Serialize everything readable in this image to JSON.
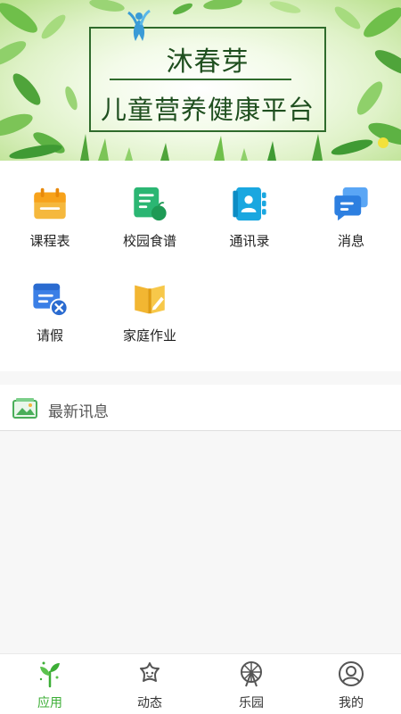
{
  "banner": {
    "title": "沐春芽",
    "subtitle": "儿童营养健康平台"
  },
  "apps": [
    {
      "label": "课程表",
      "icon": "calendar-icon"
    },
    {
      "label": "校园食谱",
      "icon": "recipe-icon"
    },
    {
      "label": "通讯录",
      "icon": "contacts-icon"
    },
    {
      "label": "消息",
      "icon": "message-icon"
    },
    {
      "label": "请假",
      "icon": "leave-icon"
    },
    {
      "label": "家庭作业",
      "icon": "homework-icon"
    }
  ],
  "news": {
    "title": "最新讯息",
    "icon": "news-image-icon"
  },
  "tabs": [
    {
      "label": "应用",
      "icon": "app-sprout-icon",
      "active": true
    },
    {
      "label": "动态",
      "icon": "dynamics-star-icon",
      "active": false
    },
    {
      "label": "乐园",
      "icon": "park-wheel-icon",
      "active": false
    },
    {
      "label": "我的",
      "icon": "profile-icon",
      "active": false
    }
  ],
  "colors": {
    "accent": "#3cae36",
    "banner_text": "#1f4f1f"
  }
}
